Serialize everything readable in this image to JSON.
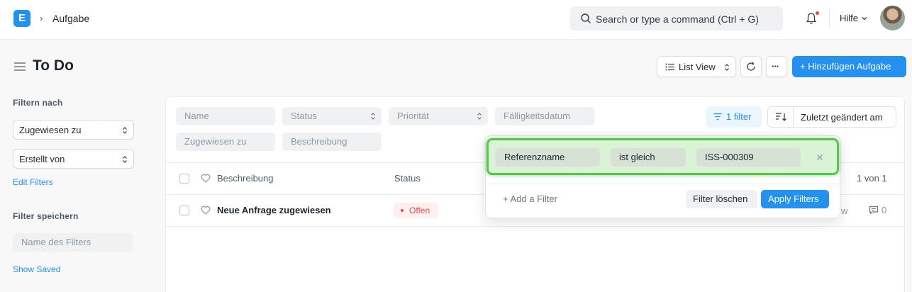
{
  "header": {
    "logo_letter": "E",
    "breadcrumb_sep": "›",
    "breadcrumb": "Aufgabe",
    "search_placeholder": "Search or type a command (Ctrl + G)",
    "help_label": "Hilfe"
  },
  "page": {
    "title": "To Do",
    "list_view_label": "List View",
    "more_label": "···",
    "add_label": "+ Hinzufügen Aufgabe"
  },
  "sidebar": {
    "filter_by_label": "Filtern nach",
    "assigned_to": "Zugewiesen zu",
    "created_by": "Erstellt von",
    "edit_filters": "Edit Filters",
    "save_filter_label": "Filter speichern",
    "filter_name_placeholder": "Name des Filters",
    "show_saved": "Show Saved"
  },
  "filters": {
    "name": "Name",
    "status": "Status",
    "priority": "Priorität",
    "due_date": "Fälligkeitsdatum",
    "assigned_to": "Zugewiesen zu",
    "description": "Beschreibung",
    "filter_count_label": "1 filter",
    "sort_label": "Zuletzt geändert am"
  },
  "table": {
    "col_description": "Beschreibung",
    "col_status": "Status",
    "page_count": "1 von 1",
    "rows": [
      {
        "title": "Neue Anfrage zugewiesen",
        "status": "Offen",
        "trailing": "w",
        "comments": "0"
      }
    ]
  },
  "filter_popup": {
    "field": "Referenzname",
    "operator": "ist gleich",
    "value": "ISS-000309",
    "add_filter": "+ Add a Filter",
    "clear": "Filter löschen",
    "apply": "Apply Filters"
  },
  "colors": {
    "primary": "#2490ef",
    "highlight": "#55c84a",
    "status_open": "#e24c4c"
  }
}
